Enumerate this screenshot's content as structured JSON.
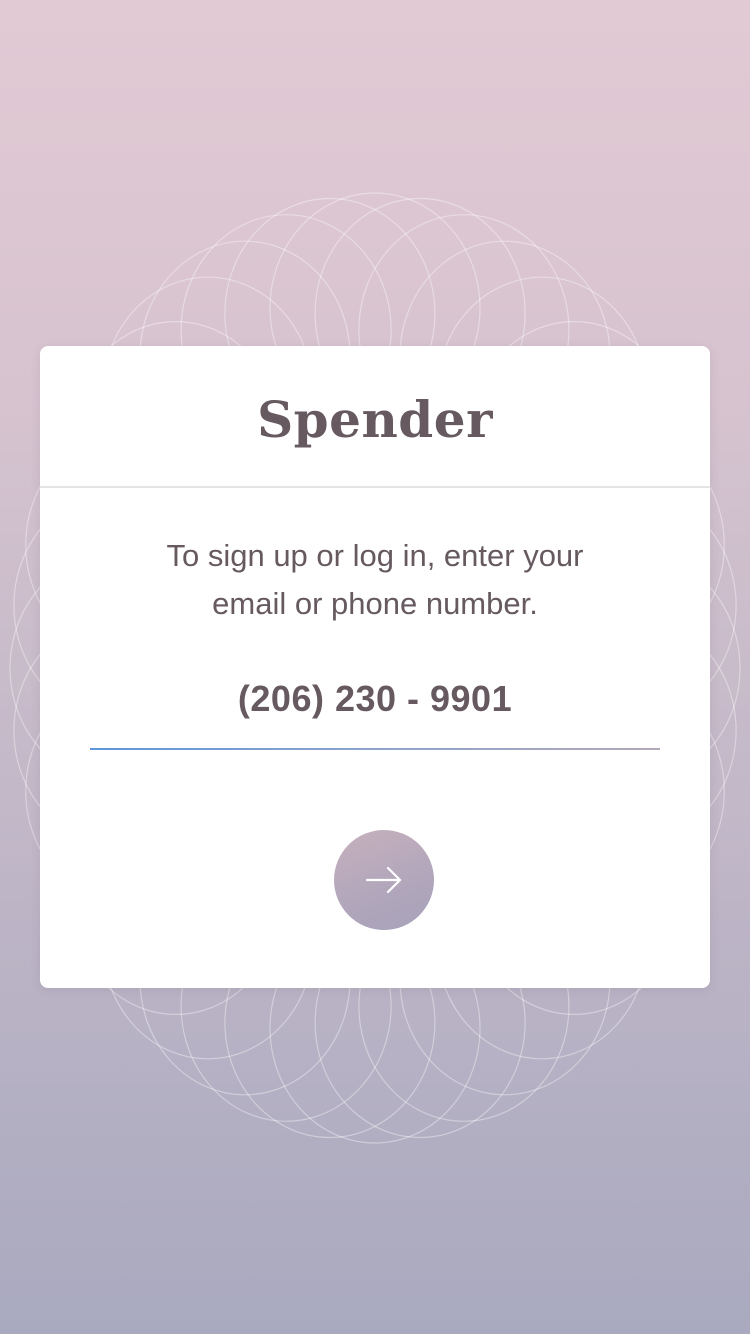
{
  "app": {
    "brand": "Spender"
  },
  "login": {
    "instruction_line1": "To sign up or log in, enter your",
    "instruction_line2": "email or phone number.",
    "phone_value": "(206) 230 - 9901"
  },
  "next_button": {
    "icon": "arrow-right-icon"
  },
  "colors": {
    "text": "#665a60",
    "background_top": "#e2cad4",
    "background_bottom": "#a9a9bf",
    "underline_accent": "#5d97dc",
    "button": "#b1a6bb"
  }
}
